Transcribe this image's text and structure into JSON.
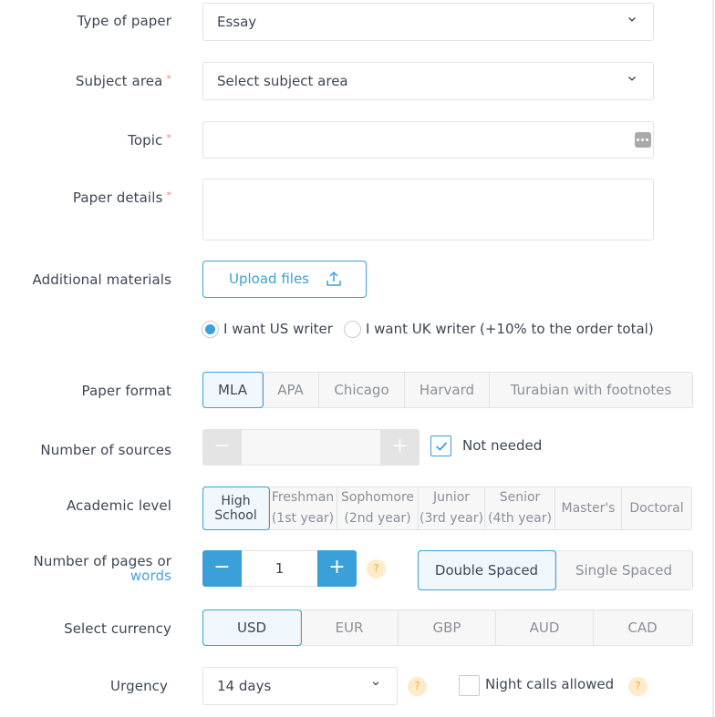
{
  "form": {
    "type_of_paper": {
      "label": "Type of paper",
      "value": "Essay"
    },
    "subject_area": {
      "label": "Subject area",
      "required_mark": "*",
      "placeholder": "Select subject area"
    },
    "topic": {
      "label": "Topic",
      "required_mark": "*",
      "value": ""
    },
    "paper_details": {
      "label": "Paper details",
      "required_mark": "*",
      "value": ""
    },
    "additional_materials": {
      "label": "Additional materials",
      "upload_label": "Upload files"
    },
    "writer": {
      "options": [
        {
          "label": "I want US writer",
          "selected": true
        },
        {
          "label": "I want UK writer (+10% to the order total)",
          "selected": false
        }
      ]
    },
    "paper_format": {
      "label": "Paper format",
      "options": [
        "MLA",
        "APA",
        "Chicago",
        "Harvard",
        "Turabian with footnotes"
      ],
      "selected": "MLA"
    },
    "sources": {
      "label": "Number of sources",
      "value": "",
      "minus": "−",
      "plus": "+",
      "not_needed_label": "Not needed",
      "not_needed_checked": true
    },
    "academic_level": {
      "label": "Academic level",
      "options": [
        {
          "line1": "High",
          "line2": "School"
        },
        {
          "line1": "Freshman",
          "line2": "(1st year)"
        },
        {
          "line1": "Sophomore",
          "line2": "(2nd year)"
        },
        {
          "line1": "Junior",
          "line2": "(3rd year)"
        },
        {
          "line1": "Senior",
          "line2": "(4th year)"
        },
        {
          "line1": "Master's",
          "line2": ""
        },
        {
          "line1": "Doctoral",
          "line2": ""
        }
      ],
      "selected": "High School"
    },
    "pages": {
      "label_line1": "Number of pages or",
      "label_link": "words",
      "value": "1",
      "minus": "−",
      "plus": "+",
      "help": "?",
      "spacing_options": [
        "Double Spaced",
        "Single Spaced"
      ],
      "spacing_selected": "Double Spaced"
    },
    "currency": {
      "label": "Select currency",
      "options": [
        "USD",
        "EUR",
        "GBP",
        "AUD",
        "CAD"
      ],
      "selected": "USD"
    },
    "urgency": {
      "label": "Urgency",
      "value": "14 days",
      "help": "?",
      "night_calls_label": "Night calls allowed",
      "night_calls_checked": false,
      "night_calls_help": "?"
    }
  },
  "colors": {
    "accent": "#3ba0da",
    "required": "#f08a6d",
    "help_bg": "#fdebc9",
    "help_fg": "#f0b040"
  }
}
